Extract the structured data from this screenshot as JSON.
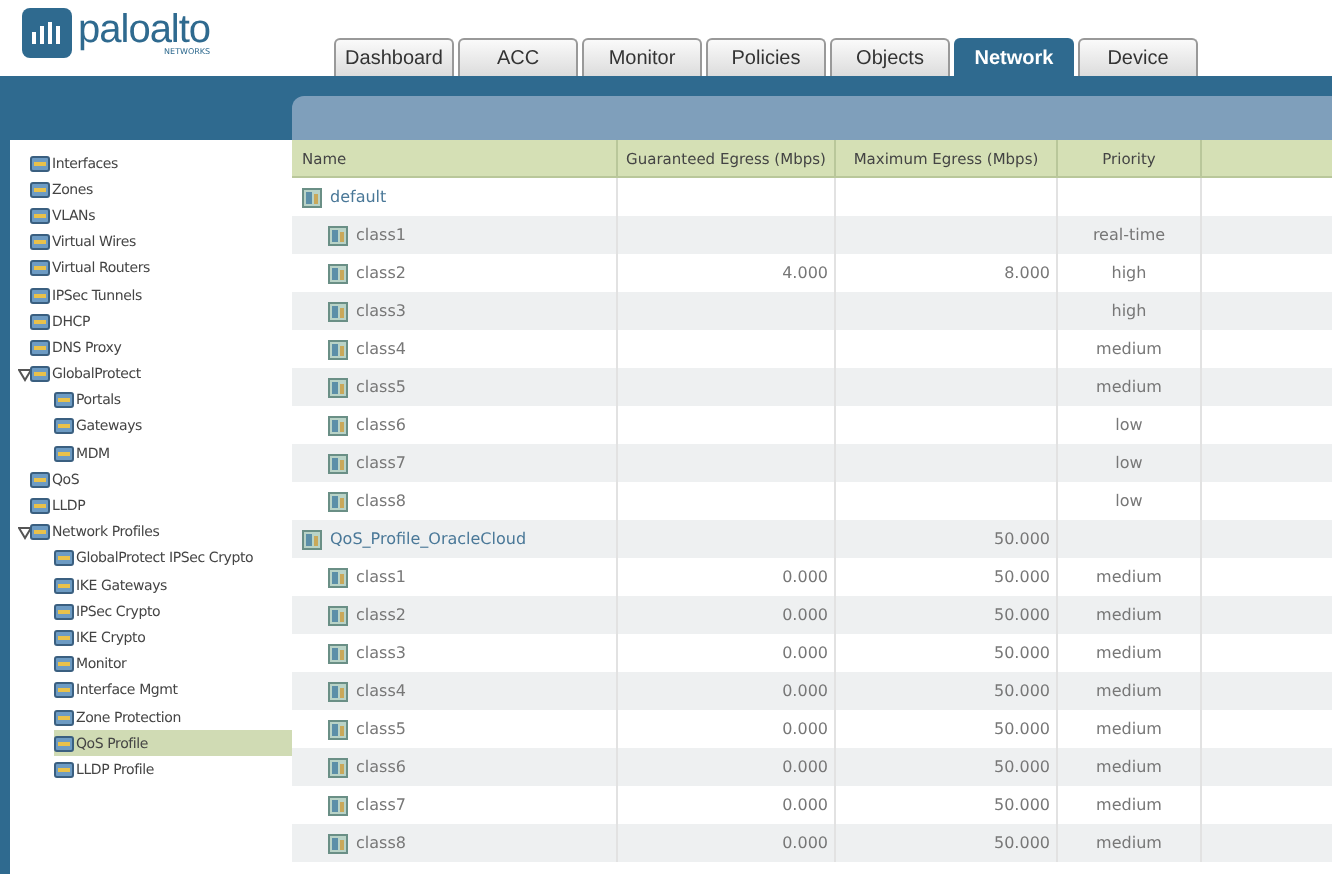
{
  "logo": {
    "name": "paloalto",
    "tagline": "NETWORKS"
  },
  "tabs": [
    {
      "label": "Dashboard",
      "selected": false
    },
    {
      "label": "ACC",
      "selected": false
    },
    {
      "label": "Monitor",
      "selected": false
    },
    {
      "label": "Policies",
      "selected": false
    },
    {
      "label": "Objects",
      "selected": false
    },
    {
      "label": "Network",
      "selected": true
    },
    {
      "label": "Device",
      "selected": false
    }
  ],
  "sidebar": {
    "items": [
      {
        "label": "Interfaces",
        "selected": false
      },
      {
        "label": "Zones",
        "selected": false
      },
      {
        "label": "VLANs",
        "selected": false
      },
      {
        "label": "Virtual Wires",
        "selected": false
      },
      {
        "label": "Virtual Routers",
        "selected": false
      },
      {
        "label": "IPSec Tunnels",
        "selected": false
      },
      {
        "label": "DHCP",
        "selected": false
      },
      {
        "label": "DNS Proxy",
        "selected": false
      },
      {
        "label": "GlobalProtect",
        "selected": false,
        "expanded": true,
        "children": [
          {
            "label": "Portals",
            "selected": false
          },
          {
            "label": "Gateways",
            "selected": false
          },
          {
            "label": "MDM",
            "selected": false
          }
        ]
      },
      {
        "label": "QoS",
        "selected": false
      },
      {
        "label": "LLDP",
        "selected": false
      },
      {
        "label": "Network Profiles",
        "selected": false,
        "expanded": true,
        "children": [
          {
            "label": "GlobalProtect IPSec Crypto",
            "selected": false
          },
          {
            "label": "IKE Gateways",
            "selected": false
          },
          {
            "label": "IPSec Crypto",
            "selected": false
          },
          {
            "label": "IKE Crypto",
            "selected": false
          },
          {
            "label": "Monitor",
            "selected": false
          },
          {
            "label": "Interface Mgmt",
            "selected": false
          },
          {
            "label": "Zone Protection",
            "selected": false
          },
          {
            "label": "QoS Profile",
            "selected": true
          },
          {
            "label": "LLDP Profile",
            "selected": false
          }
        ]
      }
    ]
  },
  "table": {
    "columns": [
      "Name",
      "Guaranteed Egress (Mbps)",
      "Maximum Egress (Mbps)",
      "Priority"
    ],
    "profiles": [
      {
        "name": "default",
        "classes": [
          {
            "name": "class1",
            "priority": "real-time"
          },
          {
            "name": "class2",
            "guaranteed": "4.000",
            "maximum": "8.000",
            "priority": "high"
          },
          {
            "name": "class3",
            "priority": "high"
          },
          {
            "name": "class4",
            "priority": "medium"
          },
          {
            "name": "class5",
            "priority": "medium"
          },
          {
            "name": "class6",
            "priority": "low"
          },
          {
            "name": "class7",
            "priority": "low"
          },
          {
            "name": "class8",
            "priority": "low"
          }
        ]
      },
      {
        "name": "QoS_Profile_OracleCloud",
        "maximum": "50.000",
        "classes": [
          {
            "name": "class1",
            "guaranteed": "0.000",
            "maximum": "50.000",
            "priority": "medium"
          },
          {
            "name": "class2",
            "guaranteed": "0.000",
            "maximum": "50.000",
            "priority": "medium"
          },
          {
            "name": "class3",
            "guaranteed": "0.000",
            "maximum": "50.000",
            "priority": "medium"
          },
          {
            "name": "class4",
            "guaranteed": "0.000",
            "maximum": "50.000",
            "priority": "medium"
          },
          {
            "name": "class5",
            "guaranteed": "0.000",
            "maximum": "50.000",
            "priority": "medium"
          },
          {
            "name": "class6",
            "guaranteed": "0.000",
            "maximum": "50.000",
            "priority": "medium"
          },
          {
            "name": "class7",
            "guaranteed": "0.000",
            "maximum": "50.000",
            "priority": "medium"
          },
          {
            "name": "class8",
            "guaranteed": "0.000",
            "maximum": "50.000",
            "priority": "medium"
          }
        ]
      }
    ]
  }
}
